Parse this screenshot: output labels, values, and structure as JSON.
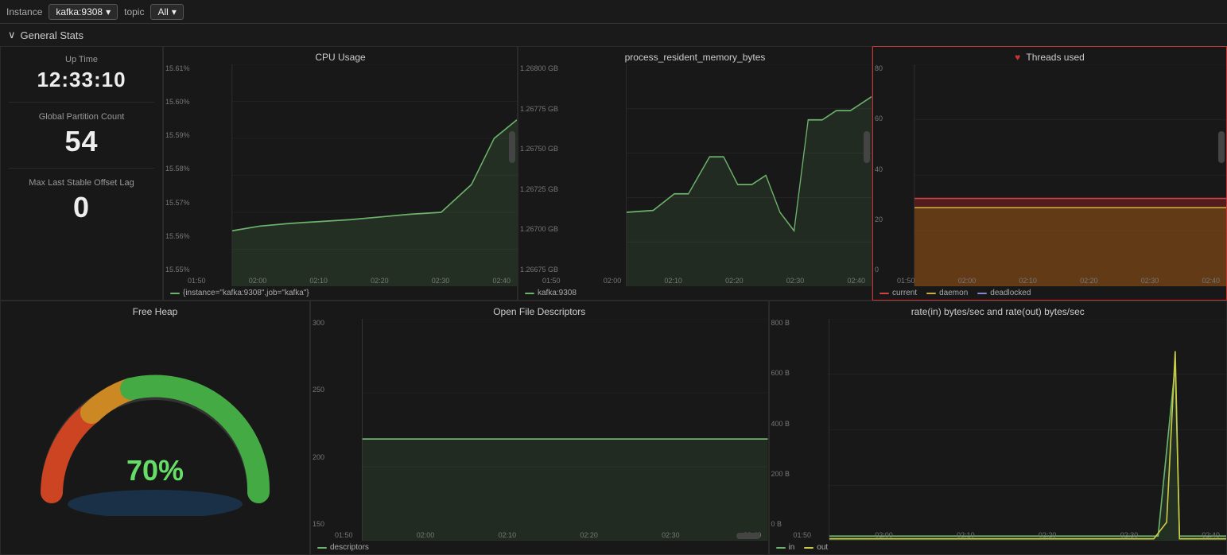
{
  "topbar": {
    "instance_label": "Instance",
    "instance_value": "kafka:9308",
    "topic_label": "topic",
    "topic_value": "All",
    "chevron": "▾"
  },
  "section": {
    "arrow": "∨",
    "title": "General Stats"
  },
  "stats": {
    "uptime_label": "Up Time",
    "uptime_value": "12:33:10",
    "partition_label": "Global Partition Count",
    "partition_value": "54",
    "offset_label": "Max Last Stable Offset Lag",
    "offset_value": "0"
  },
  "charts": {
    "cpu": {
      "title": "CPU Usage",
      "legend_label": "{instance=\"kafka:9308\",job=\"kafka\"}",
      "legend_color": "#6db36d",
      "y_labels": [
        "15.61%",
        "15.60%",
        "15.59%",
        "15.58%",
        "15.57%",
        "15.56%",
        "15.55%"
      ],
      "x_labels": [
        "01:50",
        "02:00",
        "02:10",
        "02:20",
        "02:30",
        "02:40"
      ]
    },
    "memory": {
      "title": "process_resident_memory_bytes",
      "legend_label": "kafka:9308",
      "legend_color": "#6db36d",
      "y_labels": [
        "1.26800 GB",
        "1.26775 GB",
        "1.26750 GB",
        "1.26725 GB",
        "1.26700 GB",
        "1.26675 GB"
      ],
      "x_labels": [
        "01:50",
        "02:00",
        "02:10",
        "02:20",
        "02:30",
        "02:40"
      ]
    },
    "threads": {
      "title": "Threads used",
      "alert": true,
      "legend": [
        {
          "label": "current",
          "color": "#cc4444"
        },
        {
          "label": "daemon",
          "color": "#ccaa44"
        },
        {
          "label": "deadlocked",
          "color": "#8888cc"
        }
      ],
      "y_labels": [
        "80",
        "60",
        "40",
        "20",
        "0"
      ],
      "x_labels": [
        "01:50",
        "02:00",
        "02:10",
        "02:20",
        "02:30",
        "02:40"
      ]
    },
    "heap": {
      "title": "Free Heap",
      "percent": "70%"
    },
    "files": {
      "title": "Open File Descriptors",
      "legend_label": "descriptors",
      "legend_color": "#6db36d",
      "y_labels": [
        "300",
        "250",
        "200",
        "150"
      ],
      "x_labels": [
        "01:50",
        "02:00",
        "02:10",
        "02:20",
        "02:30",
        "02:40"
      ]
    },
    "bytes": {
      "title": "rate(in) bytes/sec and rate(out) bytes/sec",
      "legend": [
        {
          "label": "in",
          "color": "#6db36d"
        },
        {
          "label": "out",
          "color": "#cccc44"
        }
      ],
      "y_labels": [
        "800 B",
        "600 B",
        "400 B",
        "200 B",
        "0 B"
      ],
      "x_labels": [
        "01:50",
        "02:00",
        "02:10",
        "02:20",
        "02:30",
        "02:40"
      ]
    }
  }
}
